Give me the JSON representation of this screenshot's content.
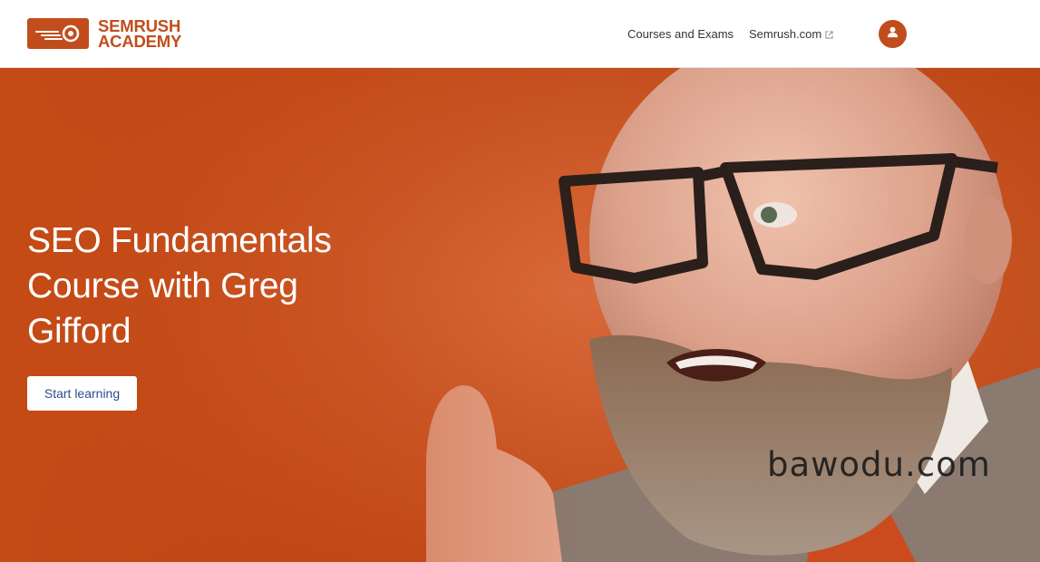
{
  "header": {
    "logo": {
      "line1": "SEMRUSH",
      "line2": "ACADEMY"
    },
    "nav": {
      "courses_label": "Courses and Exams",
      "semrush_label": "Semrush.com"
    }
  },
  "hero": {
    "title": "SEO Fundamentals Course with Greg Gifford",
    "cta_label": "Start learning"
  },
  "watermark": "bawodu.com",
  "colors": {
    "brand": "#c24d1c",
    "hero_bg": "#c44a16",
    "button_text": "#2a4d8f"
  },
  "icons": {
    "logo": "semrush-fireball-icon",
    "external": "external-link-icon",
    "user": "user-icon"
  }
}
